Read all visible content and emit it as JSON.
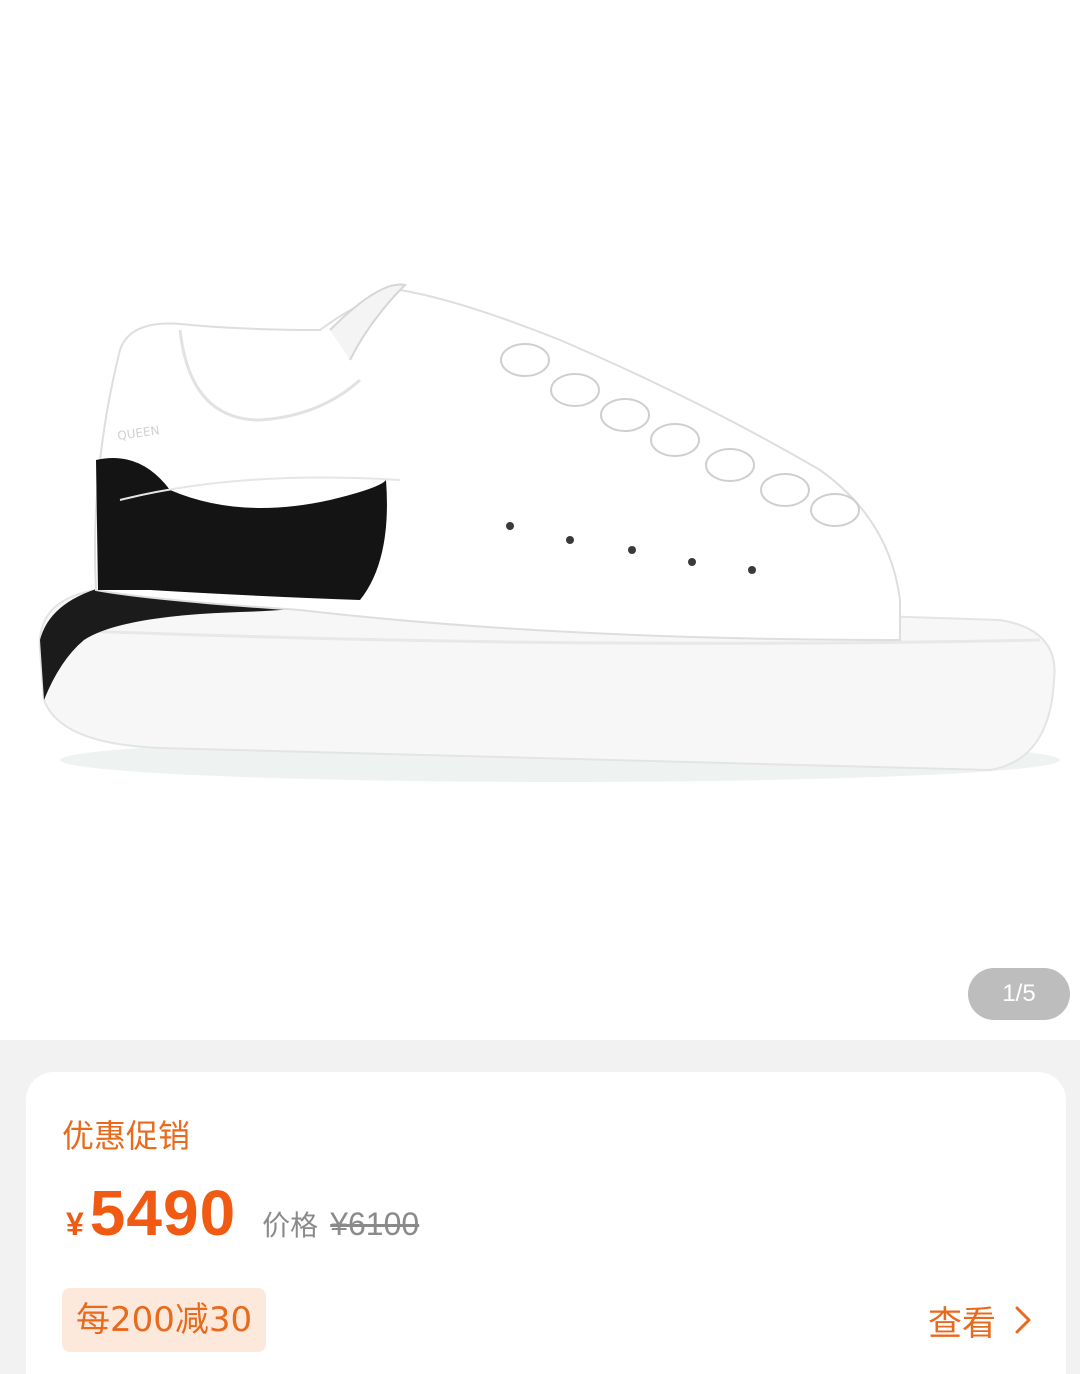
{
  "gallery": {
    "indicator": "1/5",
    "image_alt": "white sneaker with black heel tab"
  },
  "promo": {
    "title": "优惠促销",
    "currency_symbol": "¥",
    "price": "5490",
    "original_price_label": "价格",
    "original_price": "¥6100",
    "coupon_label": "每200减30",
    "view_label": "查看"
  },
  "colors": {
    "accent": "#e86a1d",
    "price": "#f05a12",
    "coupon_bg": "#fde9dc"
  }
}
